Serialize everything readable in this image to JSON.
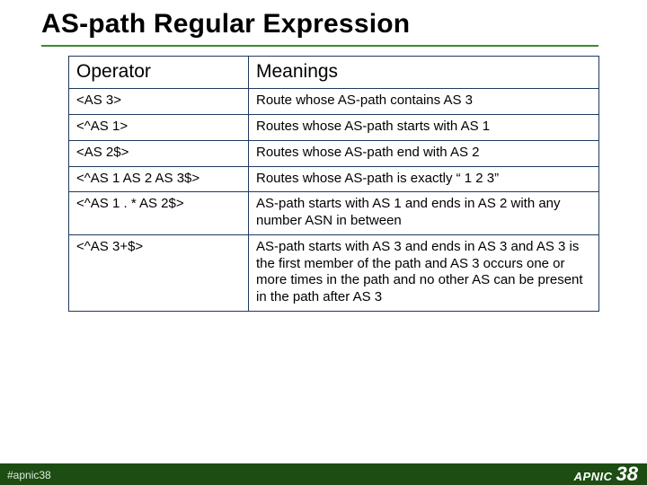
{
  "title": "AS-path Regular Expression",
  "columns": {
    "c1": "Operator",
    "c2": "Meanings"
  },
  "rows": [
    {
      "op": "<AS 3>",
      "mean": "Route whose AS-path contains AS 3"
    },
    {
      "op": "<^AS 1>",
      "mean": "Routes whose AS-path starts with AS 1"
    },
    {
      "op": "<AS 2$>",
      "mean": "Routes whose AS-path end with AS 2"
    },
    {
      "op": "<^AS 1 AS 2 AS 3$>",
      "mean": "Routes whose AS-path is exactly “ 1 2 3”"
    },
    {
      "op": "<^AS 1 . * AS 2$>",
      "mean": "AS-path starts with AS 1 and ends in AS 2 with any number ASN in between"
    },
    {
      "op": "<^AS 3+$>",
      "mean": "AS-path starts with AS 3 and ends in AS 3 and AS 3 is the first member of the path and AS 3 occurs one or more times in the path and no other AS can be present in the path after AS 3"
    }
  ],
  "footer": {
    "hashtag": "#apnic38",
    "brand": "APNIC",
    "brand_num": "38"
  }
}
